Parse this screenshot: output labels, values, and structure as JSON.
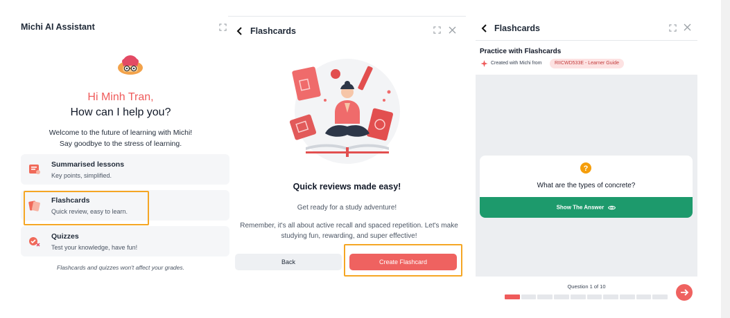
{
  "panel1": {
    "title": "Michi AI Assistant",
    "greeting": "Hi Minh Tran,",
    "greeting2": "How can I help you?",
    "welcome_line1": "Welcome to the future of learning with Michi!",
    "welcome_line2": "Say goodbye to the stress of learning.",
    "options": [
      {
        "title": "Summarised lessons",
        "subtitle": "Key points, simplified."
      },
      {
        "title": "Flashcards",
        "subtitle": "Quick review, easy to learn."
      },
      {
        "title": "Quizzes",
        "subtitle": "Test your knowledge, have fun!"
      }
    ],
    "disclaimer": "Flashcards and quizzes won't affect your grades."
  },
  "panel2": {
    "title": "Flashcards",
    "heading": "Quick reviews made easy!",
    "subheading": "Get ready for a study adventure!",
    "description": "Remember, it's all about active recall and spaced repetition. Let's make studying fun, rewarding, and super effective!",
    "back_label": "Back",
    "create_label": "Create Flashcard"
  },
  "panel3": {
    "title": "Flashcards",
    "practice_title": "Practice with Flashcards",
    "created_with": "Created with Michi from",
    "source_badge": "RIICWD533E - Learner Guide",
    "question": "What are the types of concrete?",
    "show_answer": "Show The Answer",
    "question_counter": "Question 1 of 10",
    "progress_current": 1,
    "progress_total": 10
  },
  "colors": {
    "accent": "#ef5b5b",
    "green": "#1d9a6c",
    "highlight": "#f5a623",
    "orange_icon": "#f59e0b"
  },
  "icons": [
    "expand-icon",
    "close-icon",
    "chevron-left-icon",
    "michi-mascot-icon",
    "summary-icon",
    "flashcard-icon",
    "quiz-icon",
    "sparkle-icon",
    "question-icon",
    "eye-icon",
    "arrow-right-icon"
  ]
}
